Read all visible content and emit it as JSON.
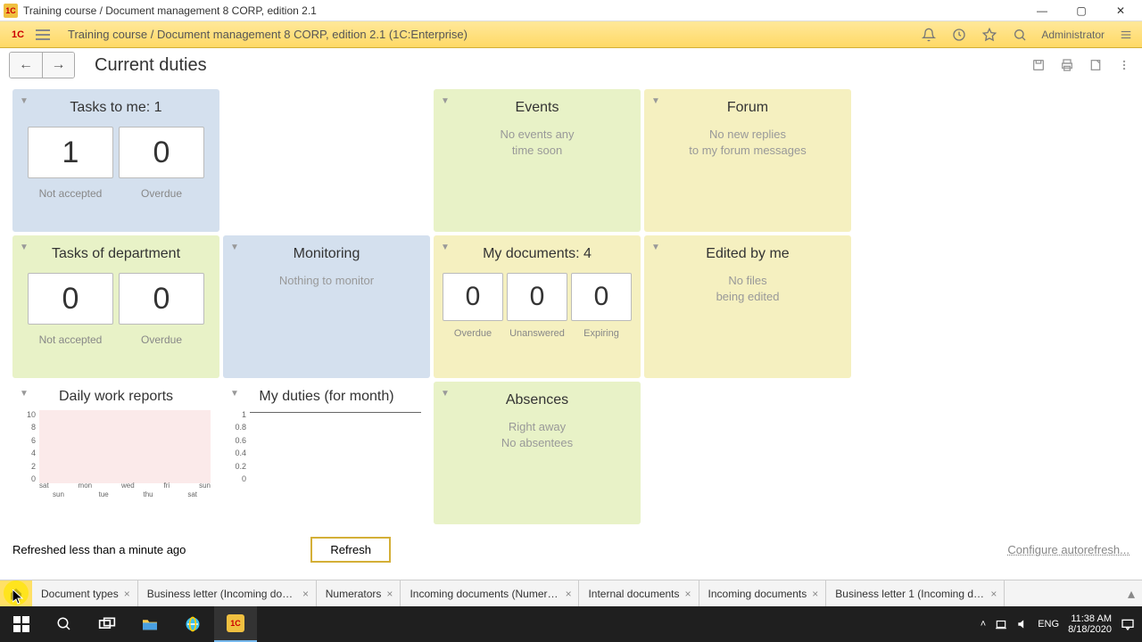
{
  "titlebar": {
    "text": "Training course / Document management 8 CORP, edition 2.1"
  },
  "appheader": {
    "title": "Training course / Document management 8 CORP, edition 2.1  (1C:Enterprise)",
    "user": "Administrator"
  },
  "page": {
    "title": "Current duties"
  },
  "widgets": {
    "tasks_me": {
      "title": "Tasks to me: 1",
      "not_accepted": {
        "value": "1",
        "label": "Not accepted"
      },
      "overdue": {
        "value": "0",
        "label": "Overdue"
      }
    },
    "events": {
      "title": "Events",
      "line1": "No events any",
      "line2": "time soon"
    },
    "forum": {
      "title": "Forum",
      "line1": "No new replies",
      "line2": "to my forum messages"
    },
    "tasks_dept": {
      "title": "Tasks of department",
      "not_accepted": {
        "value": "0",
        "label": "Not accepted"
      },
      "overdue": {
        "value": "0",
        "label": "Overdue"
      }
    },
    "monitoring": {
      "title": "Monitoring",
      "msg": "Nothing to monitor"
    },
    "my_docs": {
      "title": "My documents: 4",
      "overdue": {
        "value": "0",
        "label": "Overdue"
      },
      "unanswered": {
        "value": "0",
        "label": "Unanswered"
      },
      "expiring": {
        "value": "0",
        "label": "Expiring"
      }
    },
    "edited": {
      "title": "Edited by me",
      "line1": "No files",
      "line2": "being edited"
    },
    "daily_reports": {
      "title": "Daily work reports"
    },
    "my_duties": {
      "title": "My duties (for month)"
    },
    "absences": {
      "title": "Absences",
      "line1": "Right away",
      "line2": "No absentees"
    }
  },
  "chart_data": [
    {
      "type": "bar",
      "title": "Daily work reports",
      "categories": [
        "sat",
        "sun",
        "mon",
        "tue",
        "wed",
        "thu",
        "fri",
        "sat",
        "sun"
      ],
      "values": [
        0,
        0,
        0,
        0,
        0,
        0,
        0,
        0,
        0
      ],
      "ylim": [
        0,
        10
      ],
      "yticks": [
        0,
        2,
        4,
        6,
        8,
        10
      ]
    },
    {
      "type": "line",
      "title": "My duties (for month)",
      "x": [
        0
      ],
      "values": [
        1
      ],
      "ylim": [
        0,
        1
      ],
      "yticks": [
        0,
        0.2,
        0.4,
        0.6,
        0.8,
        1
      ]
    }
  ],
  "footer": {
    "refreshed": "Refreshed less than a minute ago",
    "refresh_btn": "Refresh",
    "configure": "Configure autorefresh..."
  },
  "tabs": [
    "Document types",
    "Business letter (Incoming docu...",
    "Numerators",
    "Incoming documents (Numerat...",
    "Internal documents",
    "Incoming documents",
    "Business letter 1 (Incoming do..."
  ],
  "taskbar": {
    "lang": "ENG",
    "time": "11:38 AM",
    "date": "8/18/2020"
  }
}
